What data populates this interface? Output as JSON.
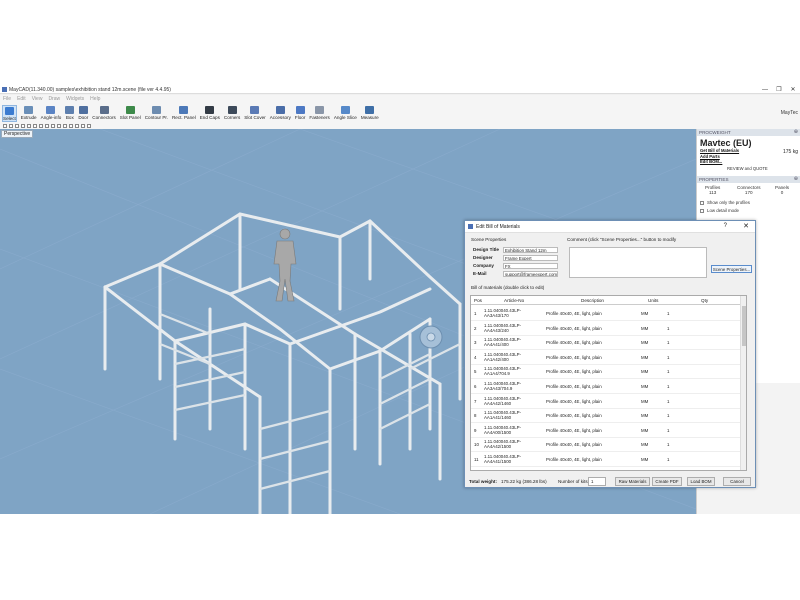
{
  "app": {
    "title": "MayCAD(11.340.00) samples\\exhibition stand 12m.scene (file ver 4.4.95)",
    "logo": "MayTec",
    "window_buttons": [
      "—",
      "❐",
      "✕"
    ]
  },
  "menu": [
    "File",
    "Edit",
    "View",
    "Draw",
    "Widgets",
    "Help"
  ],
  "toolbar": [
    {
      "label": "Select",
      "color": "#3b7bd0"
    },
    {
      "label": "Extrude",
      "color": "#6a8fb8"
    },
    {
      "label": "Angle-info",
      "color": "#5b84c4"
    },
    {
      "label": "Box",
      "color": "#5d7fae"
    },
    {
      "label": "Door",
      "color": "#4f6f9f"
    },
    {
      "label": "Connectors",
      "color": "#5a6d8a"
    },
    {
      "label": "Slot Panel",
      "color": "#3d8a4a"
    },
    {
      "label": "Contour Pr.",
      "color": "#6d8cb0"
    },
    {
      "label": "Rect. Panel",
      "color": "#4c79b8"
    },
    {
      "label": "End Caps",
      "color": "#333b45"
    },
    {
      "label": "Corners",
      "color": "#3d4a5a"
    },
    {
      "label": "Slot Cover",
      "color": "#5a7ab5"
    },
    {
      "label": "Accessory",
      "color": "#4a6da8"
    },
    {
      "label": "Floor",
      "color": "#4d79c4"
    },
    {
      "label": "Fasteners",
      "color": "#8a96a8"
    },
    {
      "label": "Angle Slice",
      "color": "#5689c9"
    },
    {
      "label": "Measure",
      "color": "#3f6fa7"
    }
  ],
  "viewport": {
    "label": "Perspective",
    "bg": "#7fa4c5"
  },
  "right_panel": {
    "procweight": {
      "title": "PROCWEIGHT",
      "brand": "Mavtec (EU)",
      "links": [
        "Get Bill of Materials",
        "Add Parts",
        "Edit BOM..."
      ],
      "weight": "175 kg",
      "review": "REVIEW and QUOTE"
    },
    "properties": {
      "title": "PROPERTIES",
      "profiles_label": "Profiles",
      "profiles_value": "113",
      "connectors_label": "Connectors",
      "connectors_value": "170",
      "panels_label": "Panels",
      "panels_value": "0",
      "show_only_profiles": "Show only the profiles",
      "low_detail_mode": "Low detail mode"
    }
  },
  "dialog": {
    "title": "Edit Bill of Materials",
    "help": "?",
    "close": "✕",
    "scene_props_label": "Scene Properties",
    "comment_label": "Comment (click \"Scene Properties...\" button to modify",
    "fields": [
      {
        "label": "Design Title",
        "value": "Exhibition Stand 12m"
      },
      {
        "label": "Designer",
        "value": "Frame Expert"
      },
      {
        "label": "Company",
        "value": "FX"
      },
      {
        "label": "E-Mail",
        "value": "support@frameexpert.com"
      }
    ],
    "scene_btn": "Scene Properties...",
    "bom_label": "Bill of materials (double click to edit)",
    "columns": [
      "Pos",
      "Article-No",
      "Description",
      "Units",
      "Qty"
    ],
    "rows": [
      {
        "pos": "1",
        "art": "1.11.040040.43LP-AA3A43/170",
        "desc": "Profile 40x40, 4E, light, plain",
        "units": "MM",
        "qty": "1"
      },
      {
        "pos": "2",
        "art": "1.11.040040.43LP-AA4A43/240",
        "desc": "Profile 40x40, 4E, light, plain",
        "units": "MM",
        "qty": "1"
      },
      {
        "pos": "3",
        "art": "1.11.040040.43LP-AA4A41/400",
        "desc": "Profile 40x40, 4E, light, plain",
        "units": "MM",
        "qty": "1"
      },
      {
        "pos": "4",
        "art": "1.11.040040.43LP-AA1A42/400",
        "desc": "Profile 40x40, 4E, light, plain",
        "units": "MM",
        "qty": "1"
      },
      {
        "pos": "5",
        "art": "1.11.040040.43LP-AA1A4/704.9",
        "desc": "Profile 40x40, 4E, light, plain",
        "units": "MM",
        "qty": "1"
      },
      {
        "pos": "6",
        "art": "1.11.040040.43LP-AA3A43/704.9",
        "desc": "Profile 40x40, 4E, light, plain",
        "units": "MM",
        "qty": "1"
      },
      {
        "pos": "7",
        "art": "1.11.040040.43LP-AA4A42/1460",
        "desc": "Profile 40x40, 4E, light, plain",
        "units": "MM",
        "qty": "1"
      },
      {
        "pos": "8",
        "art": "1.11.040040.43LP-AA1A41/1460",
        "desc": "Profile 40x40, 4E, light, plain",
        "units": "MM",
        "qty": "1"
      },
      {
        "pos": "9",
        "art": "1.11.040040.43LP-AA4A00/1500",
        "desc": "Profile 40x40, 4E, light, plain",
        "units": "MM",
        "qty": "1"
      },
      {
        "pos": "10",
        "art": "1.11.040040.43LP-AA4A42/1500",
        "desc": "Profile 40x40, 4E, light, plain",
        "units": "MM",
        "qty": "1"
      },
      {
        "pos": "11",
        "art": "1.11.040040.43LP-AA4A41/1500",
        "desc": "Profile 40x40, 4E, light, plain",
        "units": "MM",
        "qty": "1"
      },
      {
        "pos": "12",
        "art": "1.11.040040.43LP-",
        "desc": "",
        "units": "",
        "qty": ""
      }
    ],
    "total_weight_label": "Total weight:",
    "total_weight_value": "175.22 kg (386.28 lbs)",
    "kits_label": "Number of kits:",
    "kits_value": "1",
    "buttons": {
      "raw": "Raw Materials",
      "pdf": "Create PDF",
      "load": "Load BOM",
      "cancel": "Cancel"
    }
  }
}
